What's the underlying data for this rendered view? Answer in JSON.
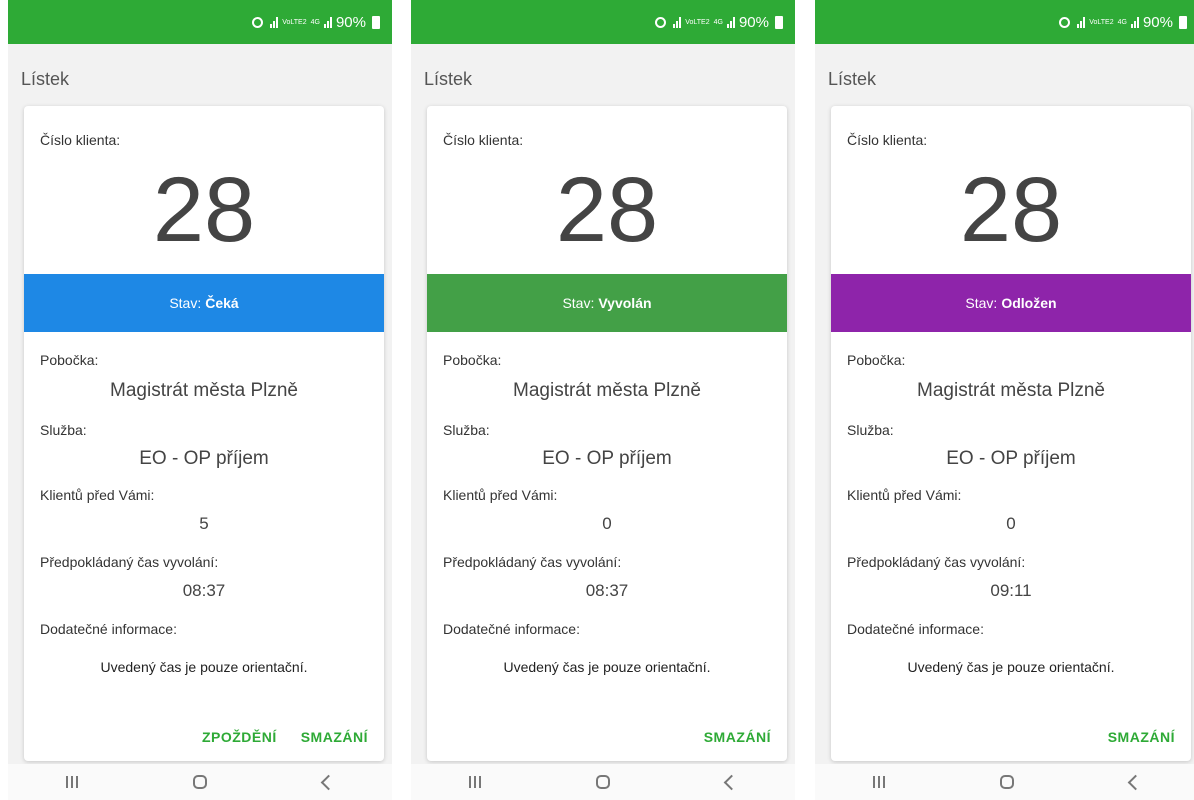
{
  "screens": [
    {
      "status_bar": {
        "network": "VoLTE2",
        "network_type": "4G",
        "battery": "90%"
      },
      "app_title": "Lístek",
      "labels": {
        "client_number": "Číslo klienta:",
        "branch": "Pobočka:",
        "service": "Služba:",
        "clients_ahead": "Klientů před Vámi:",
        "expected_time": "Předpokládaný čas vyvolání:",
        "additional_info": "Dodatečné informace:"
      },
      "client_number": "28",
      "status": {
        "prefix": "Stav:",
        "value": "Čeká",
        "color": "#1e88e5"
      },
      "branch": "Magistrát města Plzně",
      "service": "EO - OP příjem",
      "clients_ahead": "5",
      "expected_time": "08:37",
      "additional_info": "Uvedený čas je pouze orientační.",
      "actions": [
        "ZPOŽDĚNÍ",
        "SMAZÁNÍ"
      ]
    },
    {
      "status_bar": {
        "network": "VoLTE2",
        "network_type": "4G",
        "battery": "90%"
      },
      "app_title": "Lístek",
      "labels": {
        "client_number": "Číslo klienta:",
        "branch": "Pobočka:",
        "service": "Služba:",
        "clients_ahead": "Klientů před Vámi:",
        "expected_time": "Předpokládaný čas vyvolání:",
        "additional_info": "Dodatečné informace:"
      },
      "client_number": "28",
      "status": {
        "prefix": "Stav:",
        "value": "Vyvolán",
        "color": "#43a047"
      },
      "branch": "Magistrát města Plzně",
      "service": "EO - OP příjem",
      "clients_ahead": "0",
      "expected_time": "08:37",
      "additional_info": "Uvedený čas je pouze orientační.",
      "actions": [
        "SMAZÁNÍ"
      ]
    },
    {
      "status_bar": {
        "network": "VoLTE2",
        "network_type": "4G",
        "battery": "90%"
      },
      "app_title": "Lístek",
      "labels": {
        "client_number": "Číslo klienta:",
        "branch": "Pobočka:",
        "service": "Služba:",
        "clients_ahead": "Klientů před Vámi:",
        "expected_time": "Předpokládaný čas vyvolání:",
        "additional_info": "Dodatečné informace:"
      },
      "client_number": "28",
      "status": {
        "prefix": "Stav:",
        "value": "Odložen",
        "color": "#8e24aa"
      },
      "branch": "Magistrát města Plzně",
      "service": "EO - OP příjem",
      "clients_ahead": "0",
      "expected_time": "09:11",
      "additional_info": "Uvedený čas je pouze orientační.",
      "actions": [
        "SMAZÁNÍ"
      ]
    }
  ],
  "theme": {
    "accent": "#2eaa36",
    "background": "#f2f2f2"
  }
}
